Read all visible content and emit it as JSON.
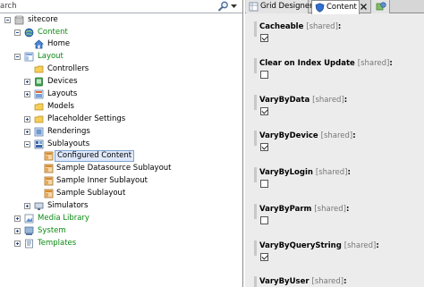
{
  "search": {
    "value": "arch"
  },
  "tree": {
    "root": "sitecore",
    "content": "Content",
    "home": "Home",
    "layout": "Layout",
    "controllers": "Controllers",
    "devices": "Devices",
    "layouts": "Layouts",
    "models": "Models",
    "placeholder_settings": "Placeholder Settings",
    "renderings": "Renderings",
    "sublayouts": "Sublayouts",
    "configured_content": "Configured Content",
    "sample_datasource": "Sample Datasource Sublayout",
    "sample_inner": "Sample Inner Sublayout",
    "sample_sublayout": "Sample Sublayout",
    "simulators": "Simulators",
    "media_library": "Media Library",
    "system": "System",
    "templates": "Templates"
  },
  "tabs": {
    "grid_designer": "Grid Designer",
    "content": "Content"
  },
  "shared_tag": "[shared]",
  "fields": [
    {
      "name": "Cacheable",
      "checked": true
    },
    {
      "name": "Clear on Index Update",
      "checked": false
    },
    {
      "name": "VaryByData",
      "checked": true
    },
    {
      "name": "VaryByDevice",
      "checked": true
    },
    {
      "name": "VaryByLogin",
      "checked": false
    },
    {
      "name": "VaryByParm",
      "checked": false
    },
    {
      "name": "VaryByQueryString",
      "checked": true
    },
    {
      "name": "VaryByUser",
      "checked": false
    }
  ],
  "colors": {
    "green_item": "#0a8a12",
    "selection": "#dfe9fb",
    "selection_border": "#7da2ce"
  }
}
